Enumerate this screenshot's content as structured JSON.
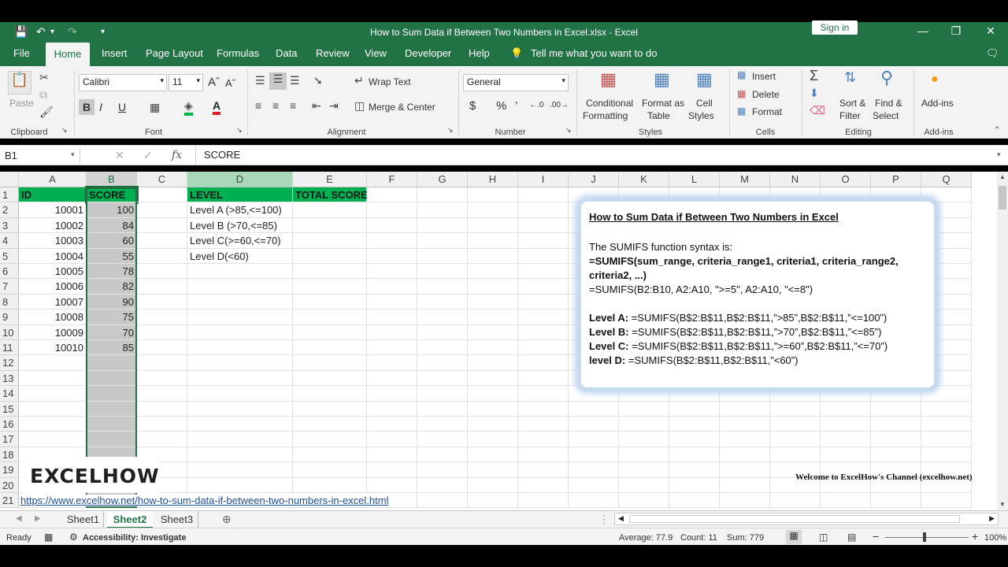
{
  "window": {
    "title": "How to Sum Data if Between Two Numbers in Excel.xlsx  -  Excel",
    "signin_label": "Sign in"
  },
  "tabs": [
    "File",
    "Home",
    "Insert",
    "Page Layout",
    "Formulas",
    "Data",
    "Review",
    "View",
    "Developer",
    "Help"
  ],
  "tell_me": "Tell me what you want to do",
  "ribbon": {
    "clipboard": {
      "paste": "Paste",
      "group": "Clipboard"
    },
    "font": {
      "name": "Calibri",
      "size": "11",
      "group": "Font"
    },
    "alignment": {
      "wrap": "Wrap Text",
      "merge": "Merge & Center",
      "group": "Alignment"
    },
    "number": {
      "format": "General",
      "group": "Number"
    },
    "styles": {
      "cond1": "Conditional",
      "cond2": "Formatting",
      "fmt1": "Format as",
      "fmt2": "Table",
      "cell1": "Cell",
      "cell2": "Styles",
      "group": "Styles"
    },
    "cells": {
      "insert": "Insert",
      "delete": "Delete",
      "format": "Format",
      "group": "Cells"
    },
    "editing": {
      "sort1": "Sort &",
      "sort2": "Filter",
      "find1": "Find &",
      "find2": "Select",
      "group": "Editing"
    },
    "addins": {
      "label": "Add-ins",
      "group": "Add-ins"
    }
  },
  "formula_bar": {
    "name_box": "B1",
    "fx": "fx",
    "value": "SCORE"
  },
  "columns": [
    "A",
    "B",
    "C",
    "D",
    "E",
    "F",
    "G",
    "H",
    "I",
    "J",
    "K",
    "L",
    "M",
    "N",
    "O",
    "P",
    "Q"
  ],
  "rows": [
    "1",
    "2",
    "3",
    "4",
    "5",
    "6",
    "7",
    "8",
    "9",
    "10",
    "11",
    "12",
    "13",
    "14",
    "15",
    "16",
    "17",
    "18",
    "19",
    "20",
    "21"
  ],
  "headers": {
    "a": "ID",
    "b": "SCORE",
    "d": "LEVEL",
    "e": "TOTAL SCORE"
  },
  "ids": [
    "10001",
    "10002",
    "10003",
    "10004",
    "10005",
    "10006",
    "10007",
    "10008",
    "10009",
    "10010"
  ],
  "scores": [
    "100",
    "84",
    "60",
    "55",
    "78",
    "82",
    "90",
    "75",
    "70",
    "85"
  ],
  "levels": [
    "Level A (>85,<=100)",
    "Level B (>70,<=85)",
    "Level C(>=60,<=70)",
    "Level D(<60)"
  ],
  "infobox": {
    "title": "How to Sum Data if Between Two Numbers in Excel",
    "l1": "The SUMIFS function syntax is:",
    "l2": " =SUMIFS(sum_range, criteria_range1, criteria1, criteria_range2,",
    "l3": "criteria2, ...)",
    "l4": "=SUMIFS(B2:B10, A2:A10, \">=5\", A2:A10, \"<=8\")",
    "a_label": "Level A:",
    "a_formula": "  =SUMIFS(B$2:B$11,B$2:B$11,”>85”,B$2:B$11,”<=100”)",
    "b_label": "Level B:",
    "b_formula": " =SUMIFS(B$2:B$11,B$2:B$11,”>70”,B$2:B$11,”<=85”)",
    "c_label": "Level C:",
    "c_formula": " =SUMIFS(B$2:B$11,B$2:B$11,”>=60”,B$2:B$11,”<=70”)",
    "d_label": "level D:",
    "d_formula": " =SUMIFS(B$2:B$11,B$2:B$11,”<60”)"
  },
  "overlay": {
    "brand": "EXCELHOW",
    "welcome": "Welcome to ExcelHow's  Channel (excelhow.net)",
    "url": "https://www.excelhow.net/how-to-sum-data-if-between-two-numbers-in-excel.html"
  },
  "sheets": [
    "Sheet1",
    "Sheet2",
    "Sheet3"
  ],
  "status": {
    "ready": "Ready",
    "accessibility": "Accessibility: Investigate",
    "average": "Average: 77.9",
    "count": "Count: 11",
    "sum": "Sum: 779",
    "zoom": "100%"
  },
  "colors": {
    "excel_green": "#217346",
    "header_fill": "#00b050",
    "selection": "#c8c8c8"
  }
}
